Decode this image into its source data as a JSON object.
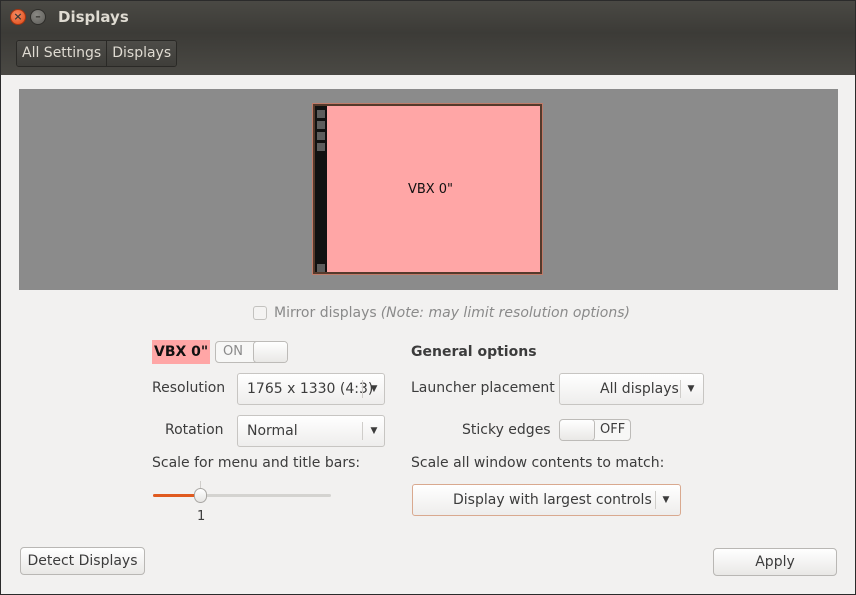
{
  "window": {
    "title": "Displays"
  },
  "breadcrumb": {
    "items": [
      "All Settings",
      "Displays"
    ]
  },
  "preview": {
    "monitor_label": "VBX 0\"",
    "monitor_color": "#ffa6a6"
  },
  "mirror": {
    "label": "Mirror displays",
    "note": "(Note: may limit resolution options)",
    "checked": false
  },
  "display": {
    "name": "VBX 0\"",
    "power_switch": {
      "state_label": "ON",
      "on": true
    },
    "resolution": {
      "label": "Resolution",
      "value": "1765 x 1330 (4:3)"
    },
    "rotation": {
      "label": "Rotation",
      "value": "Normal"
    },
    "scale": {
      "label": "Scale for menu and title bars:",
      "value": "1",
      "fraction": 0.27
    }
  },
  "general": {
    "heading": "General options",
    "launcher_placement": {
      "label": "Launcher placement",
      "value": "All displays"
    },
    "sticky_edges": {
      "label": "Sticky edges",
      "state_label": "OFF",
      "on": false
    },
    "scale_windows": {
      "label": "Scale all window contents to match:",
      "value": "Display with largest controls"
    }
  },
  "buttons": {
    "detect": "Detect Displays",
    "apply": "Apply"
  },
  "colors": {
    "accent": "#e05a1f",
    "titlebar": "#3c3b37",
    "window_bg": "#f2f1f0",
    "close_button": "#df4b16"
  }
}
